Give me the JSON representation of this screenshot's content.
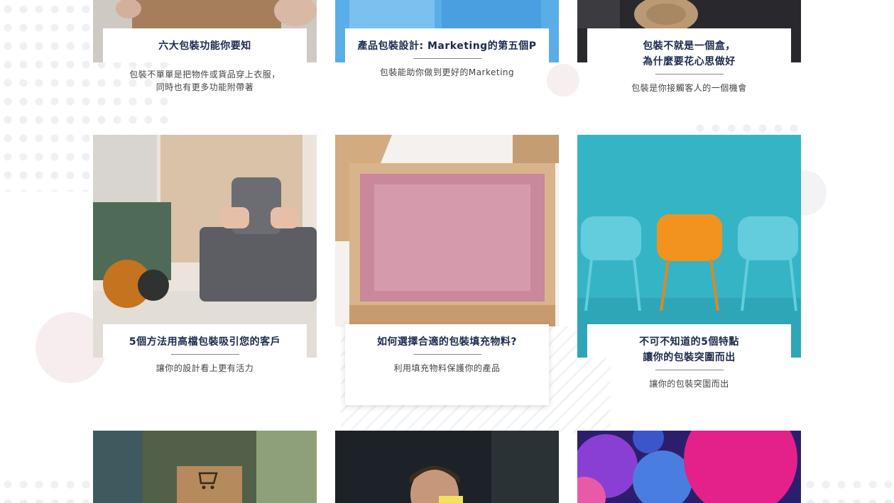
{
  "articles": [
    {
      "title": "六大包裝功能你要知",
      "desc_lines": [
        "包裝不單單是把物件或貨品穿上衣服，",
        "同時也有更多功能附帶著"
      ]
    },
    {
      "title": "產品包裝設計: Marketing的第五個P",
      "desc_lines": [
        "包裝能助你做到更好的Marketing",
        ""
      ]
    },
    {
      "title_lines": [
        "包裝不就是一個盒，",
        "為什麼要花心思做好"
      ],
      "desc_lines": [
        "包裝是你接觸客人的一個機會",
        ""
      ]
    },
    {
      "title": "5個方法用高檔包裝吸引您的客戶",
      "desc_lines": [
        "讓你的設計看上更有活力",
        ""
      ]
    },
    {
      "title": "如何選擇合適的包裝填充物料?",
      "desc_lines": [
        "利用填充物料保護你的產品",
        ""
      ]
    },
    {
      "title_lines": [
        "不可不知道的5個特點",
        "讓你的包裝突圍而出"
      ],
      "desc_lines": [
        "讓你的包裝突圍而出",
        ""
      ]
    }
  ],
  "images": [
    {
      "name": "kraft-box-hands-photo",
      "color": "#b89674"
    },
    {
      "name": "blue-bags-photo",
      "color": "#5fb0ea"
    },
    {
      "name": "twine-gift-photo",
      "color": "#2b2b2f"
    },
    {
      "name": "furoshiki-wrapping-photo",
      "color": "#6d6f74"
    },
    {
      "name": "box-shredded-paper-photo",
      "color": "#c98c9f"
    },
    {
      "name": "orange-chair-photo",
      "color": "#2fb3c6"
    },
    {
      "name": "cart-box-photo",
      "color": "#55624a"
    },
    {
      "name": "man-sticky-note-photo",
      "color": "#1c2228"
    },
    {
      "name": "colorful-balloons-photo",
      "color": "#d0187a"
    }
  ]
}
